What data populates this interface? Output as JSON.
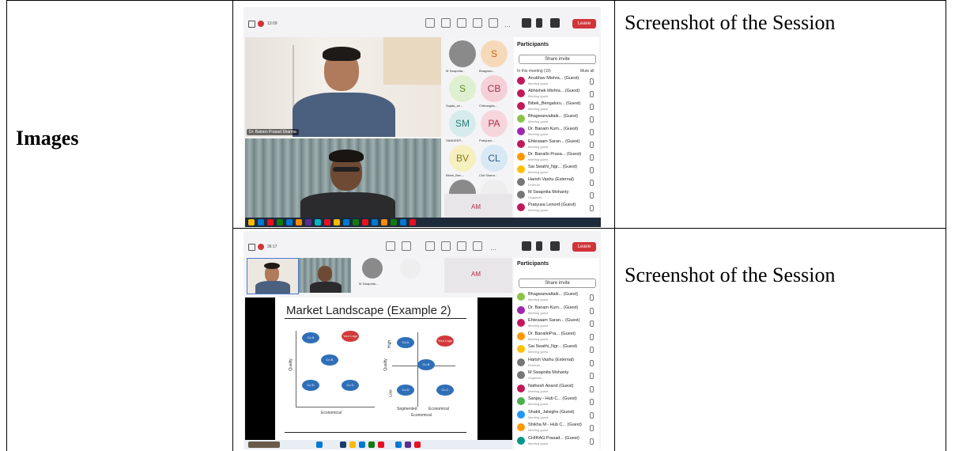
{
  "table": {
    "row_label": "Images",
    "rows": [
      {
        "caption": "Screenshot of the Session"
      },
      {
        "caption": "Screenshot of the Session"
      }
    ]
  },
  "meeting_1": {
    "timer": "13:09",
    "participants_title": "Participants",
    "share_invite": "Share invite",
    "in_meeting": "In this meeting (19)",
    "mute_all": "Mute all",
    "leave": "Leave",
    "presenter_name": "Dr. Balram Prasad Sharma",
    "participants": [
      {
        "name": "Anubhav Mishra... (Guest)",
        "sub": "Meeting guest",
        "color": "#c2185b"
      },
      {
        "name": "Abhishek Mishra... (Guest)",
        "sub": "Meeting guest",
        "color": "#c2185b"
      },
      {
        "name": "Bibek_Bengaluru... (Guest)",
        "sub": "Meeting guest",
        "color": "#c2185b"
      },
      {
        "name": "Bhagwanvaltaik... (Guest)",
        "sub": "Meeting guest",
        "color": "#8bc34a"
      },
      {
        "name": "Dr. Banam Kum... (Guest)",
        "sub": "Meeting guest",
        "color": "#9c27b0"
      },
      {
        "name": "Ehtesaam Saran... (Guest)",
        "sub": "Meeting guest",
        "color": "#c2185b"
      },
      {
        "name": "Dr. Banallo Prasa... (Guest)",
        "sub": "Meeting guest",
        "color": "#ff9800"
      },
      {
        "name": "Sai Swathi_Ngr... (Guest)",
        "sub": "Meeting guest",
        "color": "#ffc107"
      },
      {
        "name": "Harish Vashu (External)",
        "sub": "External",
        "color": "#777777"
      },
      {
        "name": "M Swapnita Mohanty",
        "sub": "Organizer",
        "color": "#777777"
      },
      {
        "name": "Pratyusa Lenord (Guest)",
        "sub": "Meeting guest",
        "color": "#c2185b"
      }
    ],
    "tiles": [
      {
        "initials": "",
        "name": "M Swapnita...",
        "bg": "#8a8a8a",
        "fg": "#ffffff"
      },
      {
        "initials": "S",
        "name": "Bhagwan...",
        "bg": "#f6d9b8",
        "fg": "#c06a1a"
      },
      {
        "initials": "S",
        "name": "Sujata_sh...",
        "bg": "#dff0d0",
        "fg": "#5a8a2a"
      },
      {
        "initials": "CB",
        "name": "Chitrangda...",
        "bg": "#f6d0d8",
        "fg": "#a0304a"
      },
      {
        "initials": "SM",
        "name": "SANDEEP...",
        "bg": "#d6ecec",
        "fg": "#2a7a7a"
      },
      {
        "initials": "PA",
        "name": "Pratyusa...",
        "bg": "#f6d6dc",
        "fg": "#b02a40"
      },
      {
        "initials": "BV",
        "name": "Bibek_Ben...",
        "bg": "#f6f0c0",
        "fg": "#8a7a10"
      },
      {
        "initials": "CL",
        "name": "Chit Sharm...",
        "bg": "#d8e8f4",
        "fg": "#2a5a8a"
      },
      {
        "initials": "",
        "name": "Harish Va...",
        "bg": "#8a8a8a",
        "fg": "#ffffff"
      },
      {
        "initials": "",
        "name": "",
        "bg": "#eeeeee",
        "fg": "#cccccc"
      }
    ],
    "am_tile": "AM"
  },
  "meeting_2": {
    "timer": "36:17",
    "participants_title": "Participants",
    "share_invite": "Share invite",
    "leave": "Leave",
    "am_tile": "AM",
    "tile_name": "M Swapnita...",
    "participants": [
      {
        "name": "Bhagwanvaltaik... (Guest)",
        "sub": "Meeting guest",
        "color": "#8bc34a"
      },
      {
        "name": "Dr. Banam Kum... (Guest)",
        "sub": "Meeting guest",
        "color": "#9c27b0"
      },
      {
        "name": "Ehtesaam Saran... (Guest)",
        "sub": "Meeting guest",
        "color": "#c2185b"
      },
      {
        "name": "Dr. BanalloPra... (Guest)",
        "sub": "Meeting guest",
        "color": "#ff9800"
      },
      {
        "name": "Sai Swathi_Ngr... (Guest)",
        "sub": "Meeting guest",
        "color": "#ffc107"
      },
      {
        "name": "Harish Vashu (External)",
        "sub": "External",
        "color": "#777777"
      },
      {
        "name": "M Swapnita Mohanty",
        "sub": "Organizer",
        "color": "#777777"
      },
      {
        "name": "Nathesh Anand (Guest)",
        "sub": "Meeting guest",
        "color": "#c2185b"
      },
      {
        "name": "Sanjay - Hub C... (Guest)",
        "sub": "Meeting guest",
        "color": "#4caf50"
      },
      {
        "name": "Shakti_Jalsighe (Guest)",
        "sub": "Meeting guest",
        "color": "#2196f3"
      },
      {
        "name": "Shikha M - Hub C... (Guest)",
        "sub": "Meeting guest",
        "color": "#ff9800"
      },
      {
        "name": "CHIRAG Prasad... (Guest)",
        "sub": "Meeting guest",
        "color": "#009688"
      }
    ],
    "slide": {
      "title": "Market Landscape (Example 2)",
      "left_y": "Quality",
      "left_x": "Economical",
      "right_y": "Quality",
      "right_x": "Economical",
      "high": "High",
      "low": "Low",
      "segmented": "Segmented",
      "economical": "Economical",
      "left_bubbles": [
        {
          "label": "Co A",
          "color": "#2f6fb8"
        },
        {
          "label": "Your Logo",
          "color": "#d23a3a"
        },
        {
          "label": "Co B",
          "color": "#2f6fb8"
        },
        {
          "label": "Co D",
          "color": "#2f6fb8"
        },
        {
          "label": "Co C",
          "color": "#2f6fb8"
        }
      ],
      "right_bubbles": [
        {
          "label": "Co A",
          "color": "#2f6fb8"
        },
        {
          "label": "Your Logo",
          "color": "#d23a3a"
        },
        {
          "label": "Co B",
          "color": "#2f6fb8"
        },
        {
          "label": "Co D",
          "color": "#2f6fb8"
        },
        {
          "label": "Co C",
          "color": "#2f6fb8"
        }
      ]
    }
  }
}
